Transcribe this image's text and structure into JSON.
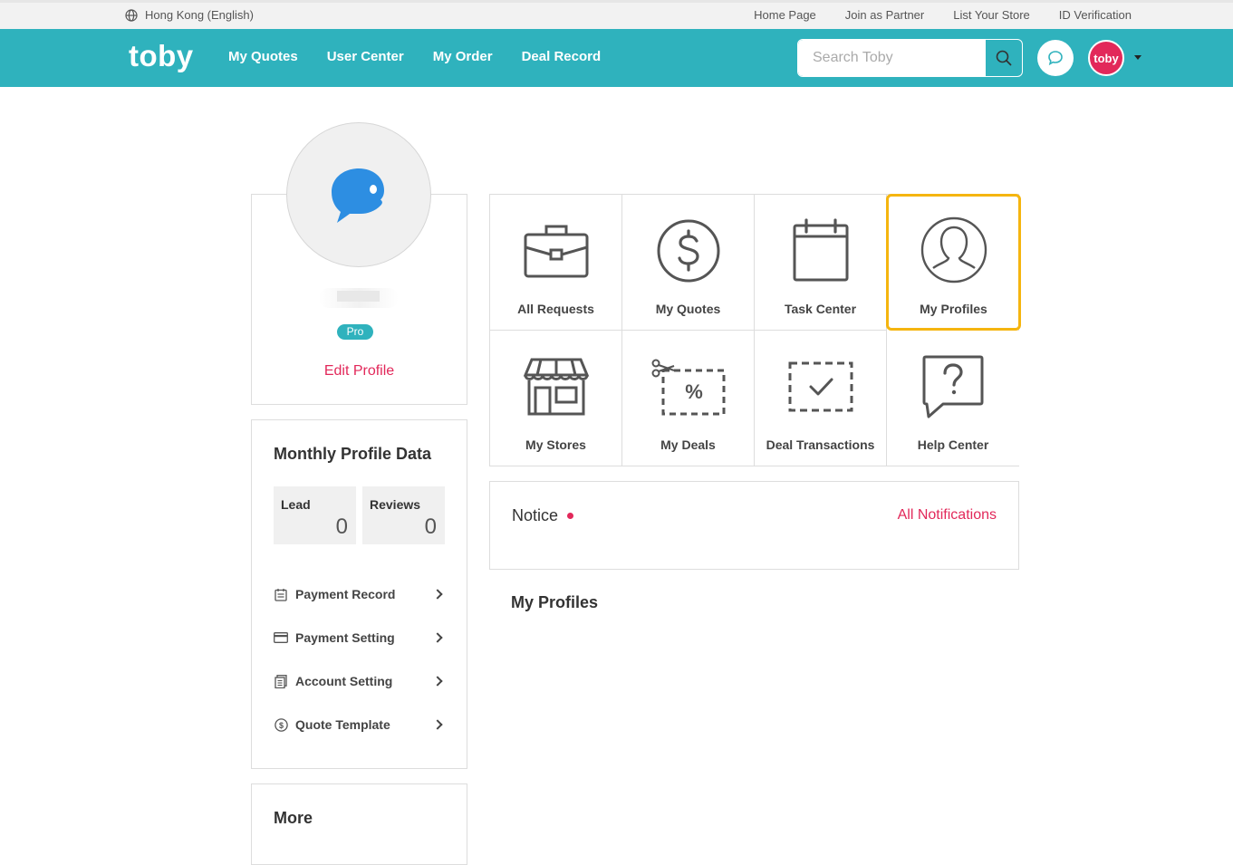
{
  "topbar": {
    "locale": "Hong Kong (English)",
    "links": [
      "Home Page",
      "Join as Partner",
      "List Your Store",
      "ID Verification"
    ]
  },
  "nav": {
    "logo": "toby",
    "links": [
      "My Quotes",
      "User Center",
      "My Order",
      "Deal Record"
    ],
    "search_placeholder": "Search Toby",
    "avatar_text": "toby"
  },
  "profile": {
    "badge": "Pro",
    "edit_label": "Edit Profile"
  },
  "monthly": {
    "title": "Monthly Profile Data",
    "stats": [
      {
        "label": "Lead",
        "value": "0"
      },
      {
        "label": "Reviews",
        "value": "0"
      }
    ],
    "menu": [
      {
        "label": "Payment Record",
        "icon": "calendar-icon"
      },
      {
        "label": "Payment Setting",
        "icon": "credit-card-icon"
      },
      {
        "label": "Account Setting",
        "icon": "document-icon"
      },
      {
        "label": "Quote Template",
        "icon": "dollar-circle-icon"
      }
    ]
  },
  "more": {
    "title": "More"
  },
  "grid": {
    "items": [
      {
        "label": "All Requests",
        "icon": "briefcase-icon"
      },
      {
        "label": "My Quotes",
        "icon": "dollar-circle-icon"
      },
      {
        "label": "Task Center",
        "icon": "calendar-icon"
      },
      {
        "label": "My Profiles",
        "icon": "user-profile-icon",
        "selected": true
      },
      {
        "label": "My Stores",
        "icon": "storefront-icon"
      },
      {
        "label": "My Deals",
        "icon": "coupon-icon"
      },
      {
        "label": "Deal Transactions",
        "icon": "checkbox-dashed-icon"
      },
      {
        "label": "Help Center",
        "icon": "question-bubble-icon"
      }
    ]
  },
  "notice": {
    "title": "Notice",
    "all_label": "All Notifications"
  },
  "section_title": "My Profiles",
  "colors": {
    "brand": "#2fb2bd",
    "accent": "#e2285a",
    "highlight": "#f5b50f"
  }
}
